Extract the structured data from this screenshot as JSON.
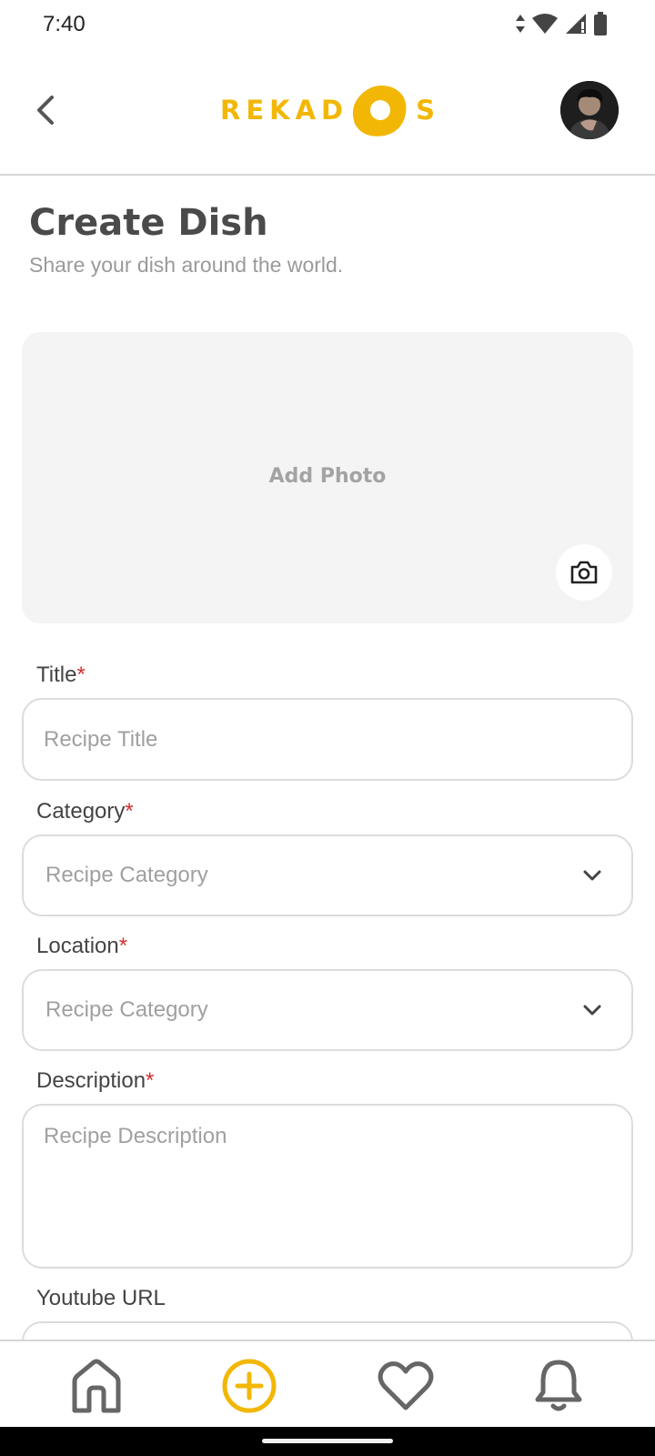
{
  "status_bar": {
    "time": "7:40",
    "icons": [
      "data-arrows-icon",
      "wifi-icon",
      "signal-icon",
      "battery-icon"
    ]
  },
  "header": {
    "logo_left": "REKAD",
    "logo_right": "S",
    "brand_color": "#F2B705"
  },
  "page": {
    "title": "Create Dish",
    "subtitle": "Share your dish around the world."
  },
  "photo": {
    "label": "Add Photo"
  },
  "form": {
    "title": {
      "label": "Title",
      "required": "*",
      "placeholder": "Recipe Title"
    },
    "category": {
      "label": "Category",
      "required": "*",
      "value": "Recipe Category"
    },
    "location": {
      "label": "Location",
      "required": "*",
      "value": "Recipe Category"
    },
    "description": {
      "label": "Description",
      "required": "*",
      "placeholder": "Recipe Description"
    },
    "youtube": {
      "label": "Youtube URL"
    }
  },
  "nav": {
    "items": [
      "home-icon",
      "add-circle-icon",
      "heart-icon",
      "bell-icon"
    ],
    "active": "add-circle-icon"
  },
  "colors": {
    "accent": "#F2B705",
    "required": "#D32F2F",
    "icon_gray": "#666666"
  }
}
